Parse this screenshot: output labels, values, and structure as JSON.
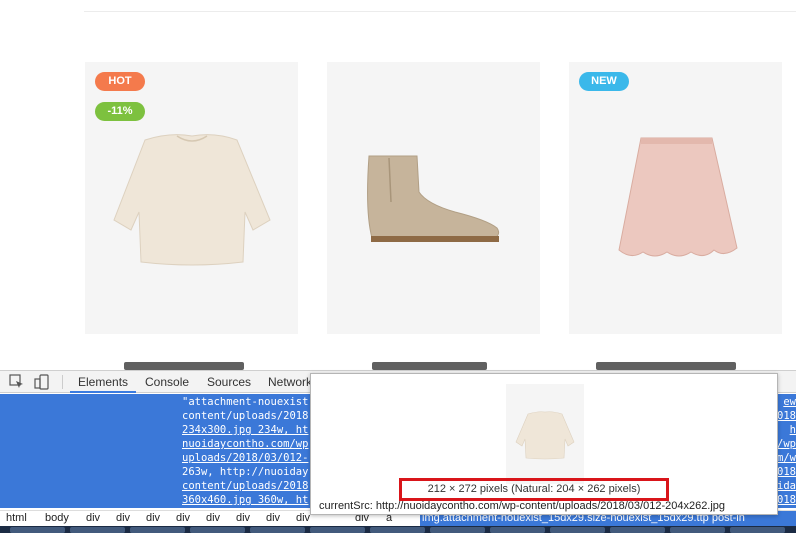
{
  "products": [
    {
      "name": "sweater",
      "badges": [
        {
          "label": "HOT",
          "color": "#f47a4c"
        },
        {
          "label": "-11%",
          "color": "#7dc13f"
        }
      ]
    },
    {
      "name": "chelsea-boot",
      "badges": []
    },
    {
      "name": "suede-skirt",
      "badges": [
        {
          "label": "NEW",
          "color": "#3ab8ea"
        }
      ]
    }
  ],
  "devtools": {
    "tabs": [
      "Elements",
      "Console",
      "Sources",
      "Network"
    ],
    "active_tab": "Elements",
    "code_lines": [
      "\"attachment-nouexist",
      "content/uploads/2018",
      "234x300.jpg 234w, ht",
      "nuoidaycontho.com/wp",
      "uploads/2018/03/012-",
      "263w, http://nuoiday",
      "content/uploads/2018",
      "360x460.jpg 360w, ht"
    ],
    "code_right": [
      "ew",
      "2018",
      "h",
      "om/wp",
      "om/w",
      "018",
      "nuoida",
      "/2018",
      "h"
    ],
    "breadcrumbs": [
      "html",
      "body",
      "div",
      "div",
      "div",
      "div",
      "div",
      "div",
      "div",
      "div",
      "div",
      "a"
    ],
    "selected_crumb": "img.attachment-nouexist_15dx29.size-nouexist_15dx29.ttp post-in"
  },
  "tooltip": {
    "dimensions": "212 × 272 pixels (Natural: 204 × 262 pixels)",
    "current_src": "currentSrc: http://nuoidaycontho.com/wp-content/uploads/2018/03/012-204x262.jpg"
  }
}
